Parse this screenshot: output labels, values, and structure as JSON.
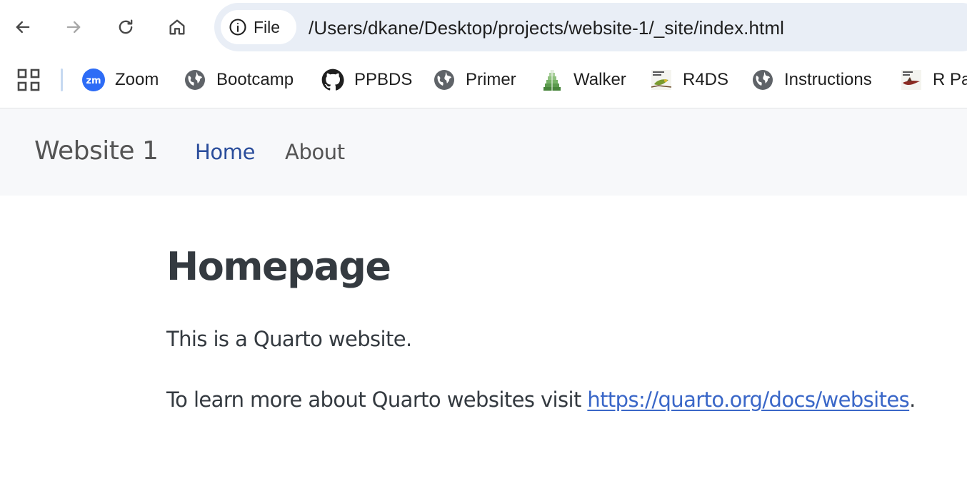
{
  "browser": {
    "site_chip_label": "File",
    "url": "/Users/dkane/Desktop/projects/website-1/_site/index.html",
    "icons": {
      "back": "arrow-left-icon",
      "forward": "arrow-right-icon",
      "reload": "reload-icon",
      "home": "home-icon",
      "info": "info-circle-icon"
    }
  },
  "bookmarks": {
    "items": [
      {
        "label": "Zoom",
        "icon": "zoom-icon"
      },
      {
        "label": "Bootcamp",
        "icon": "globe-icon"
      },
      {
        "label": "PPBDS",
        "icon": "github-icon"
      },
      {
        "label": "Primer",
        "icon": "globe-icon"
      },
      {
        "label": "Walker",
        "icon": "walker-icon"
      },
      {
        "label": "R4DS",
        "icon": "r4ds-book-icon"
      },
      {
        "label": "Instructions",
        "icon": "globe-icon"
      },
      {
        "label": "R Pa",
        "icon": "r-packages-book-icon"
      }
    ],
    "zoom_badge_text": "zm"
  },
  "site": {
    "brand": "Website 1",
    "nav": [
      {
        "label": "Home",
        "active": true
      },
      {
        "label": "About",
        "active": false
      }
    ]
  },
  "page": {
    "title": "Homepage",
    "para1": "This is a Quarto website.",
    "para2_prefix": "To learn more about Quarto websites visit ",
    "para2_link": "https://quarto.org/docs/websites",
    "para2_suffix": "."
  },
  "colors": {
    "omnibox_bg": "#e9eef6",
    "navbar_bg": "#f7f8fa",
    "active_link": "#2a4d9b",
    "body_link": "#3a67c8",
    "heading": "#343a40"
  }
}
